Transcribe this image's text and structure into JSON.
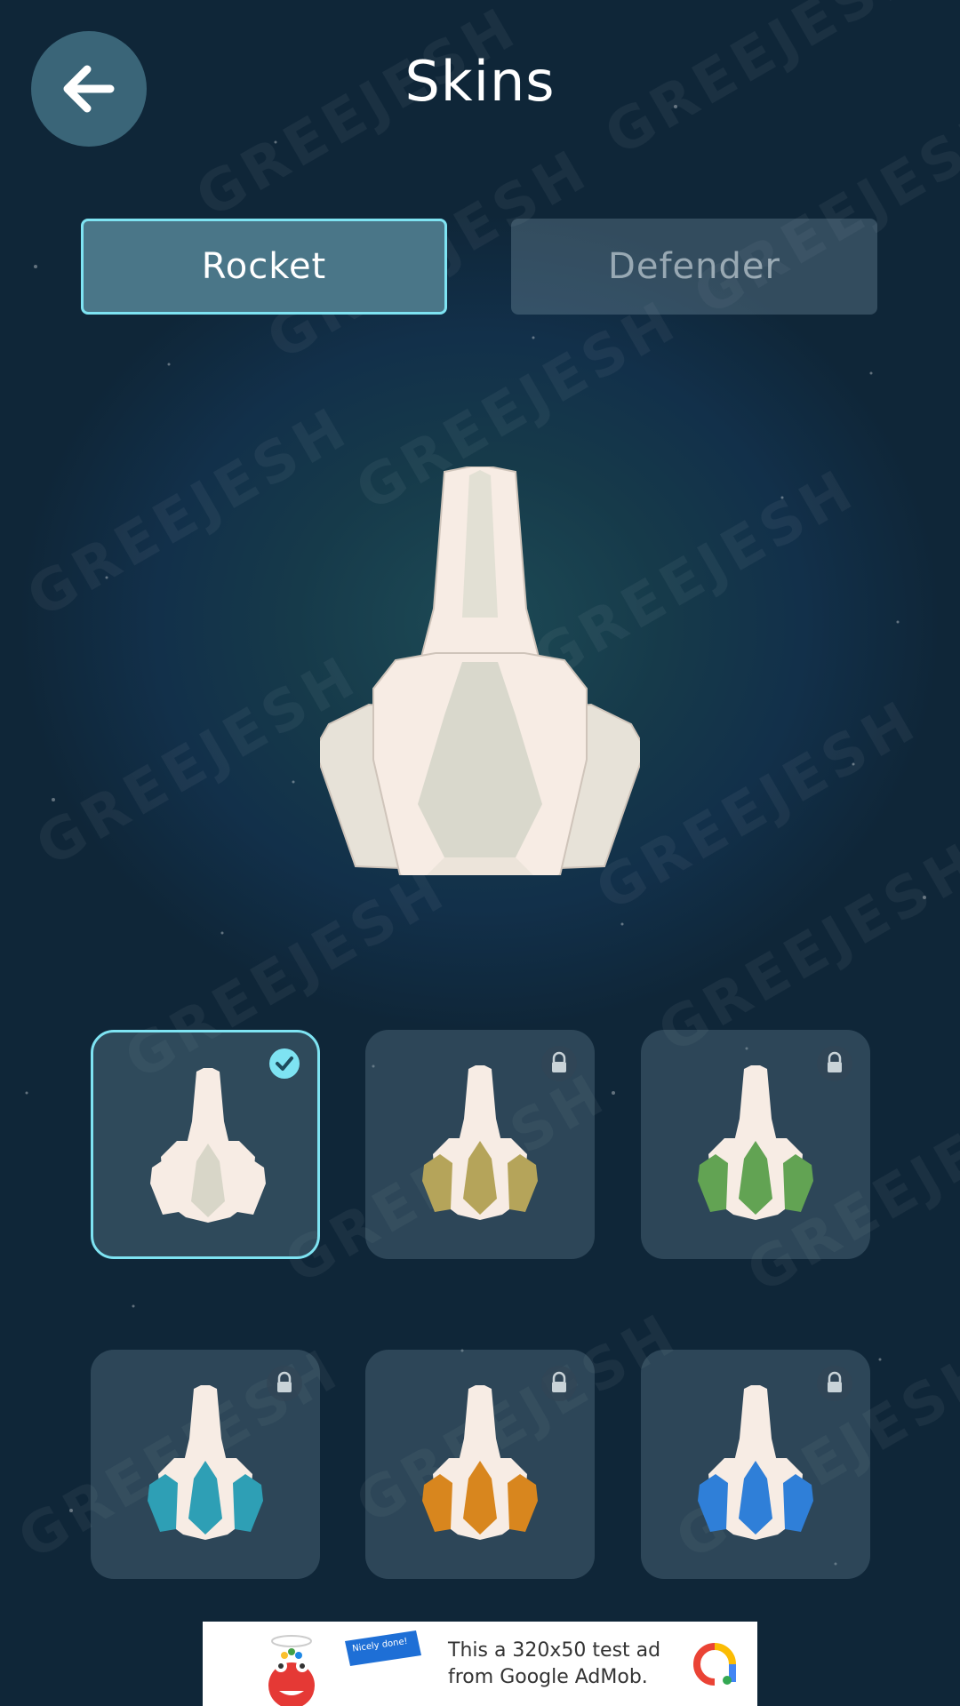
{
  "header": {
    "title": "Skins",
    "back_icon": "arrow-left-icon"
  },
  "tabs": [
    {
      "label": "Rocket",
      "active": true
    },
    {
      "label": "Defender",
      "active": false
    }
  ],
  "watermark_text": "GREEJESH",
  "preview": {
    "hull_color": "#f7ece4",
    "accent_color": "#d9d8cc"
  },
  "skins": [
    {
      "color": "#d8d6c8",
      "selected": true,
      "locked": false
    },
    {
      "color": "#b5a45a",
      "selected": false,
      "locked": true
    },
    {
      "color": "#62a353",
      "selected": false,
      "locked": true
    },
    {
      "color": "#2e9fb5",
      "selected": false,
      "locked": true
    },
    {
      "color": "#d8861e",
      "selected": false,
      "locked": true
    },
    {
      "color": "#2f7fd8",
      "selected": false,
      "locked": true
    }
  ],
  "ad": {
    "badge": "Nicely done!",
    "line1": "This a 320x50 test ad",
    "line2": "from Google AdMob."
  },
  "colors": {
    "accent": "#7ee3f2",
    "background": "#12304a"
  }
}
